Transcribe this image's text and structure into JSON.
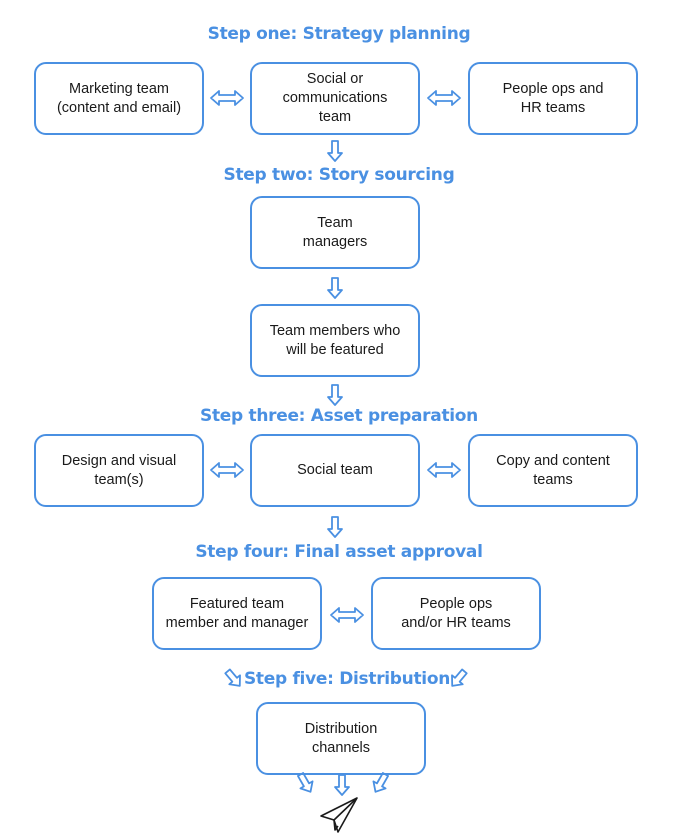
{
  "diagram": {
    "accent_color": "#4a90e2",
    "text_color": "#1a1a1a",
    "steps": [
      {
        "title": "Step one: Strategy planning",
        "boxes": [
          {
            "label": "Marketing team\n(content and email)"
          },
          {
            "label": "Social or\ncommunications\nteam"
          },
          {
            "label": "People ops and\nHR teams"
          }
        ]
      },
      {
        "title": "Step two: Story sourcing",
        "boxes": [
          {
            "label": "Team\nmanagers"
          },
          {
            "label": "Team members who\nwill be featured"
          }
        ]
      },
      {
        "title": "Step three: Asset preparation",
        "boxes": [
          {
            "label": "Design and visual\nteam(s)"
          },
          {
            "label": "Social team"
          },
          {
            "label": "Copy and content\nteams"
          }
        ]
      },
      {
        "title": "Step four: Final asset approval",
        "boxes": [
          {
            "label": "Featured team\nmember and manager"
          },
          {
            "label": "People ops\nand/or HR teams"
          }
        ]
      },
      {
        "title": "Step five: Distribution",
        "boxes": [
          {
            "label": "Distribution\nchannels"
          }
        ]
      }
    ],
    "icons": {
      "bidirectional_arrow": "double-arrow-icon",
      "down_arrow": "down-arrow-icon",
      "end_icon": "paper-plane-icon"
    }
  }
}
